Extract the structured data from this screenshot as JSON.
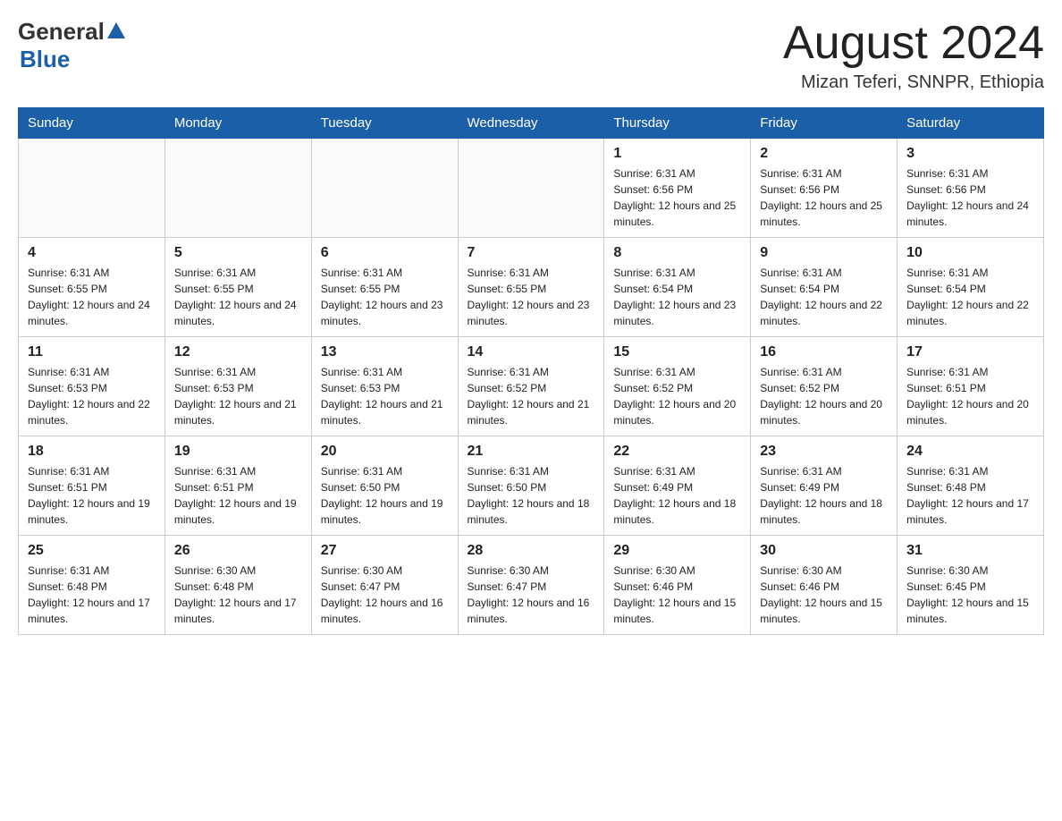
{
  "header": {
    "logo_general": "General",
    "logo_blue": "Blue",
    "month_title": "August 2024",
    "location": "Mizan Teferi, SNNPR, Ethiopia"
  },
  "days_of_week": [
    "Sunday",
    "Monday",
    "Tuesday",
    "Wednesday",
    "Thursday",
    "Friday",
    "Saturday"
  ],
  "weeks": [
    [
      {
        "day": "",
        "info": ""
      },
      {
        "day": "",
        "info": ""
      },
      {
        "day": "",
        "info": ""
      },
      {
        "day": "",
        "info": ""
      },
      {
        "day": "1",
        "info": "Sunrise: 6:31 AM\nSunset: 6:56 PM\nDaylight: 12 hours and 25 minutes."
      },
      {
        "day": "2",
        "info": "Sunrise: 6:31 AM\nSunset: 6:56 PM\nDaylight: 12 hours and 25 minutes."
      },
      {
        "day": "3",
        "info": "Sunrise: 6:31 AM\nSunset: 6:56 PM\nDaylight: 12 hours and 24 minutes."
      }
    ],
    [
      {
        "day": "4",
        "info": "Sunrise: 6:31 AM\nSunset: 6:55 PM\nDaylight: 12 hours and 24 minutes."
      },
      {
        "day": "5",
        "info": "Sunrise: 6:31 AM\nSunset: 6:55 PM\nDaylight: 12 hours and 24 minutes."
      },
      {
        "day": "6",
        "info": "Sunrise: 6:31 AM\nSunset: 6:55 PM\nDaylight: 12 hours and 23 minutes."
      },
      {
        "day": "7",
        "info": "Sunrise: 6:31 AM\nSunset: 6:55 PM\nDaylight: 12 hours and 23 minutes."
      },
      {
        "day": "8",
        "info": "Sunrise: 6:31 AM\nSunset: 6:54 PM\nDaylight: 12 hours and 23 minutes."
      },
      {
        "day": "9",
        "info": "Sunrise: 6:31 AM\nSunset: 6:54 PM\nDaylight: 12 hours and 22 minutes."
      },
      {
        "day": "10",
        "info": "Sunrise: 6:31 AM\nSunset: 6:54 PM\nDaylight: 12 hours and 22 minutes."
      }
    ],
    [
      {
        "day": "11",
        "info": "Sunrise: 6:31 AM\nSunset: 6:53 PM\nDaylight: 12 hours and 22 minutes."
      },
      {
        "day": "12",
        "info": "Sunrise: 6:31 AM\nSunset: 6:53 PM\nDaylight: 12 hours and 21 minutes."
      },
      {
        "day": "13",
        "info": "Sunrise: 6:31 AM\nSunset: 6:53 PM\nDaylight: 12 hours and 21 minutes."
      },
      {
        "day": "14",
        "info": "Sunrise: 6:31 AM\nSunset: 6:52 PM\nDaylight: 12 hours and 21 minutes."
      },
      {
        "day": "15",
        "info": "Sunrise: 6:31 AM\nSunset: 6:52 PM\nDaylight: 12 hours and 20 minutes."
      },
      {
        "day": "16",
        "info": "Sunrise: 6:31 AM\nSunset: 6:52 PM\nDaylight: 12 hours and 20 minutes."
      },
      {
        "day": "17",
        "info": "Sunrise: 6:31 AM\nSunset: 6:51 PM\nDaylight: 12 hours and 20 minutes."
      }
    ],
    [
      {
        "day": "18",
        "info": "Sunrise: 6:31 AM\nSunset: 6:51 PM\nDaylight: 12 hours and 19 minutes."
      },
      {
        "day": "19",
        "info": "Sunrise: 6:31 AM\nSunset: 6:51 PM\nDaylight: 12 hours and 19 minutes."
      },
      {
        "day": "20",
        "info": "Sunrise: 6:31 AM\nSunset: 6:50 PM\nDaylight: 12 hours and 19 minutes."
      },
      {
        "day": "21",
        "info": "Sunrise: 6:31 AM\nSunset: 6:50 PM\nDaylight: 12 hours and 18 minutes."
      },
      {
        "day": "22",
        "info": "Sunrise: 6:31 AM\nSunset: 6:49 PM\nDaylight: 12 hours and 18 minutes."
      },
      {
        "day": "23",
        "info": "Sunrise: 6:31 AM\nSunset: 6:49 PM\nDaylight: 12 hours and 18 minutes."
      },
      {
        "day": "24",
        "info": "Sunrise: 6:31 AM\nSunset: 6:48 PM\nDaylight: 12 hours and 17 minutes."
      }
    ],
    [
      {
        "day": "25",
        "info": "Sunrise: 6:31 AM\nSunset: 6:48 PM\nDaylight: 12 hours and 17 minutes."
      },
      {
        "day": "26",
        "info": "Sunrise: 6:30 AM\nSunset: 6:48 PM\nDaylight: 12 hours and 17 minutes."
      },
      {
        "day": "27",
        "info": "Sunrise: 6:30 AM\nSunset: 6:47 PM\nDaylight: 12 hours and 16 minutes."
      },
      {
        "day": "28",
        "info": "Sunrise: 6:30 AM\nSunset: 6:47 PM\nDaylight: 12 hours and 16 minutes."
      },
      {
        "day": "29",
        "info": "Sunrise: 6:30 AM\nSunset: 6:46 PM\nDaylight: 12 hours and 15 minutes."
      },
      {
        "day": "30",
        "info": "Sunrise: 6:30 AM\nSunset: 6:46 PM\nDaylight: 12 hours and 15 minutes."
      },
      {
        "day": "31",
        "info": "Sunrise: 6:30 AM\nSunset: 6:45 PM\nDaylight: 12 hours and 15 minutes."
      }
    ]
  ]
}
